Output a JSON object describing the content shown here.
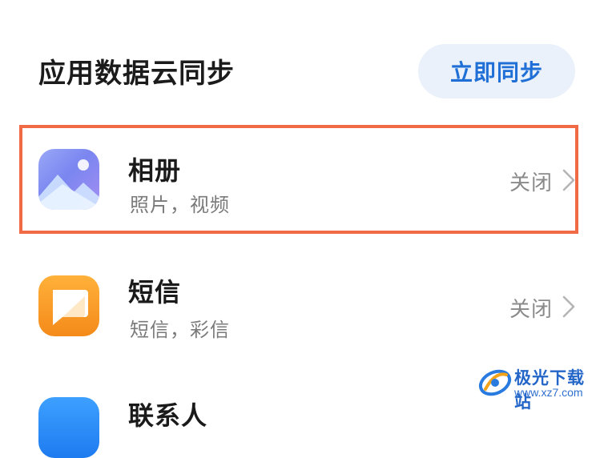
{
  "header": {
    "title": "应用数据云同步",
    "sync_button": "立即同步"
  },
  "apps": [
    {
      "name": "相册",
      "description": "照片，视频",
      "status": "关闭",
      "icon": "gallery-icon"
    },
    {
      "name": "短信",
      "description": "短信，彩信",
      "status": "关闭",
      "icon": "message-icon"
    },
    {
      "name": "联系人",
      "icon": "contacts-icon"
    }
  ],
  "watermark": {
    "name": "极光下载站",
    "url": "www.xz7.com"
  },
  "colors": {
    "accent": "#1f6fd6",
    "button_bg": "#eaf1fb",
    "highlight_border": "#f06b45"
  }
}
